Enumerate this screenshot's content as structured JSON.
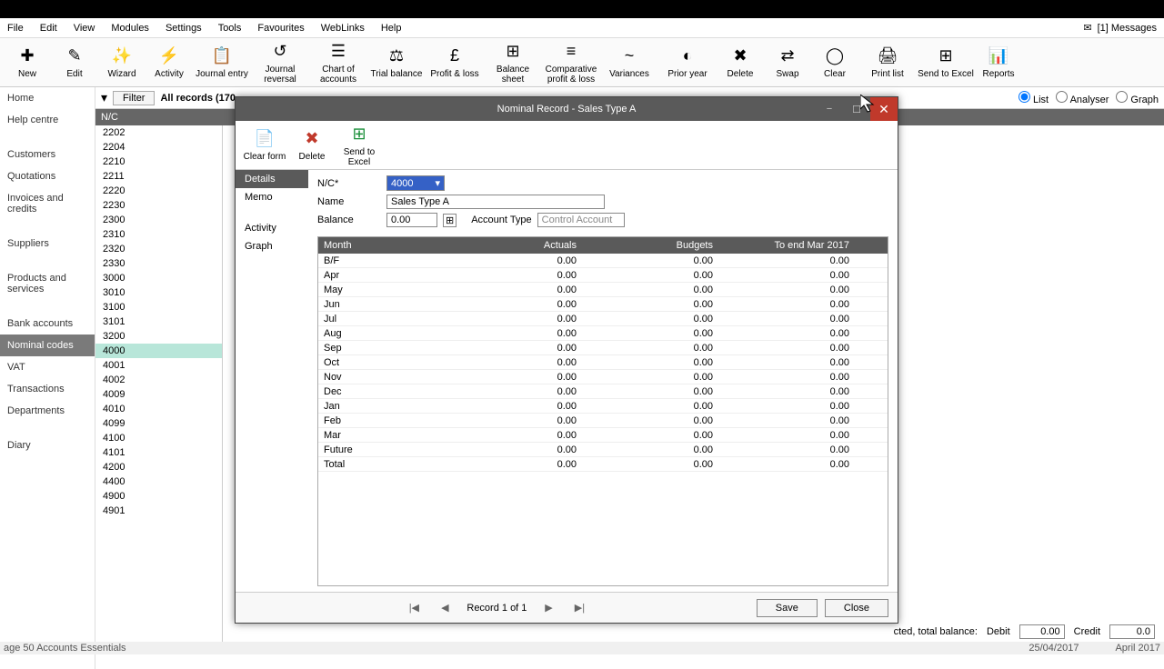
{
  "menubar": {
    "items": [
      "File",
      "Edit",
      "View",
      "Modules",
      "Settings",
      "Tools",
      "Favourites",
      "WebLinks",
      "Help"
    ],
    "messages": "[1] Messages"
  },
  "leftnav": {
    "items": [
      "Home",
      "Help centre",
      "Customers",
      "Quotations",
      "Invoices and credits",
      "Suppliers",
      "Products and services",
      "Bank accounts",
      "Nominal codes",
      "VAT",
      "Transactions",
      "Departments",
      "Diary"
    ],
    "active": "Nominal codes"
  },
  "toolbar": [
    "New",
    "Edit",
    "Wizard",
    "Activity",
    "Journal entry",
    "Journal reversal",
    "Chart of accounts",
    "Trial balance",
    "Profit & loss",
    "Balance sheet",
    "Comparative profit & loss",
    "Variances",
    "Prior year",
    "Delete",
    "Swap",
    "Clear",
    "Print list",
    "Send to Excel",
    "Reports"
  ],
  "filter": {
    "btn": "Filter",
    "label": "All records (170"
  },
  "view_radios": [
    "List",
    "Analyser",
    "Graph"
  ],
  "nc_header": "N/C",
  "nc_list": [
    "2202",
    "2204",
    "2210",
    "2211",
    "2220",
    "2230",
    "2300",
    "2310",
    "2320",
    "2330",
    "3000",
    "3010",
    "3100",
    "3101",
    "3200",
    "4000",
    "4001",
    "4002",
    "4009",
    "4010",
    "4099",
    "4100",
    "4101",
    "4200",
    "4400",
    "4900",
    "4901"
  ],
  "nc_selected": "4000",
  "dlg": {
    "title": "Nominal Record - Sales Type A",
    "toolbar": [
      "Clear form",
      "Delete",
      "Send to Excel"
    ],
    "tabs": [
      "Details",
      "Memo",
      "Activity",
      "Graph"
    ],
    "active_tab": "Details",
    "fields": {
      "nc_label": "N/C*",
      "nc_value": "4000",
      "name_label": "Name",
      "name_value": "Sales Type A",
      "balance_label": "Balance",
      "balance_value": "0.00",
      "account_type_label": "Account Type",
      "account_type_value": "Control Account"
    },
    "table": {
      "headers": [
        "Month",
        "Actuals",
        "Budgets",
        "To end Mar 2017"
      ],
      "rows": [
        {
          "m": "B/F",
          "a": "0.00",
          "b": "0.00",
          "e": "0.00"
        },
        {
          "m": "Apr",
          "a": "0.00",
          "b": "0.00",
          "e": "0.00"
        },
        {
          "m": "May",
          "a": "0.00",
          "b": "0.00",
          "e": "0.00"
        },
        {
          "m": "Jun",
          "a": "0.00",
          "b": "0.00",
          "e": "0.00"
        },
        {
          "m": "Jul",
          "a": "0.00",
          "b": "0.00",
          "e": "0.00"
        },
        {
          "m": "Aug",
          "a": "0.00",
          "b": "0.00",
          "e": "0.00"
        },
        {
          "m": "Sep",
          "a": "0.00",
          "b": "0.00",
          "e": "0.00"
        },
        {
          "m": "Oct",
          "a": "0.00",
          "b": "0.00",
          "e": "0.00"
        },
        {
          "m": "Nov",
          "a": "0.00",
          "b": "0.00",
          "e": "0.00"
        },
        {
          "m": "Dec",
          "a": "0.00",
          "b": "0.00",
          "e": "0.00"
        },
        {
          "m": "Jan",
          "a": "0.00",
          "b": "0.00",
          "e": "0.00"
        },
        {
          "m": "Feb",
          "a": "0.00",
          "b": "0.00",
          "e": "0.00"
        },
        {
          "m": "Mar",
          "a": "0.00",
          "b": "0.00",
          "e": "0.00"
        },
        {
          "m": "Future",
          "a": "0.00",
          "b": "0.00",
          "e": "0.00"
        },
        {
          "m": "Total",
          "a": "0.00",
          "b": "0.00",
          "e": "0.00"
        }
      ]
    },
    "record_nav": "Record 1 of 1",
    "save": "Save",
    "close": "Close"
  },
  "status": {
    "balance_label": "cted, total balance:",
    "debit_label": "Debit",
    "debit_value": "0.00",
    "credit_label": "Credit",
    "credit_value": "0.0",
    "date": "25/04/2017",
    "period": "April 2017"
  },
  "app_footer": "age 50 Accounts Essentials"
}
